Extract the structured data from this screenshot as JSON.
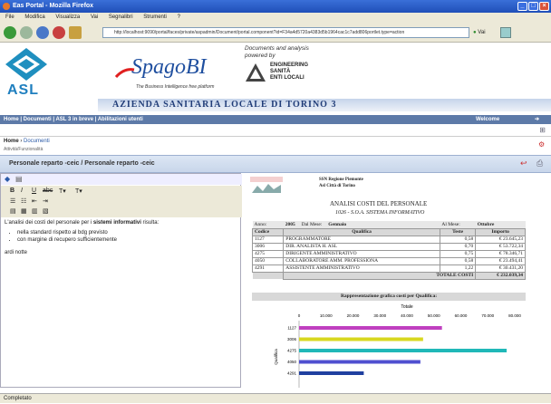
{
  "window": {
    "title": "Eas Portal - Mozilla Firefox"
  },
  "menu": [
    "File",
    "Modifica",
    "Visualizza",
    "Vai",
    "Segnalibri",
    "Strumenti",
    "?"
  ],
  "nav": {
    "url": "http://localhost:9090/portal/faces/private/aspadmin/Document/portal.component?id=F34a4d5720a4383d5b1964cac1c7add806portlet.type=action",
    "go_label": "Vai"
  },
  "banner": {
    "asl": "ASL",
    "spago": "SpagoBI",
    "spago_sub": "The Business Intelligence free platform",
    "docs_line1": "Documents and analysis",
    "docs_line2": "powered by",
    "eng1": "ENGINEERING",
    "eng2": "SANITÀ",
    "eng3": "ENTI LOCALI",
    "azienda": "AZIENDA SANITARIA LOCALE DI TORINO 3"
  },
  "topnav": "Home | Documenti | ASL 3 in breve | Abilitazioni utenti",
  "topnav_right": "Welcome",
  "breadcrumb": {
    "home": "Home",
    "sep": " › ",
    "current": "Documenti",
    "sub": "Attività/Funzionalità"
  },
  "panel": {
    "title": "Personale reparto -ceic / Personale reparto -ceic"
  },
  "editor": {
    "intro_plain": "L'analisi dei costi del personale per i ",
    "intro_bold": "sistemi informativi",
    "intro_end": " risulta:",
    "bullets": [
      "nella standard rispetto al bdg previsto",
      "con margine di recupero sufficientemente"
    ],
    "footer": "ardi notte"
  },
  "report": {
    "org1": "SSN Regione Piemonte",
    "org2": "Asl Città di Torino",
    "title": "ANALISI COSTI DEL PERSONALE",
    "subtitle": "1026 - S.O.A. SISTEMA INFORMATIVO",
    "filter": {
      "anno_label": "Anno:",
      "anno": "2005",
      "dal_label": "Dal Mese:",
      "dal": "Gennaio",
      "al_label": "Al Mese:",
      "al": "Ottobre"
    },
    "headers": [
      "Codice",
      "Qualifica",
      "Teste",
      "Importo"
    ],
    "rows": [
      [
        "1127",
        "PROGRAMMATORE",
        "0,58",
        "€ 23.645,23"
      ],
      [
        "3006",
        "DIR. ANALISTA H. ASL",
        "0,70",
        "€ 53.722,34"
      ],
      [
        "4275",
        "DIRIGENTE AMMINISTRATIVO",
        "0,75",
        "€ 78.346,71"
      ],
      [
        "4050",
        "COLLABORATORE AMM. PROFESSIONA",
        "0,58",
        "€ 23.494,41"
      ],
      [
        "4291",
        "ASSISTENTE AMMINISTRATIVO",
        "1,22",
        "€ 30.431,20"
      ]
    ],
    "total_label": "TOTALE COSTI",
    "total": "€ 232.039,34",
    "chart_title": "Rappresentazione grafica costi per Qualifica:"
  },
  "chart_data": {
    "type": "bar",
    "orientation": "horizontal",
    "title": "Totale",
    "ylabel": "Qualifica",
    "categories": [
      "1127",
      "3006",
      "4275",
      "4050",
      "4291"
    ],
    "values": [
      53000,
      46000,
      77000,
      45000,
      24000
    ],
    "xlim": [
      0,
      80000
    ],
    "ticks": [
      "0",
      "10.000",
      "20.000",
      "30.000",
      "40.000",
      "50.000",
      "60.000",
      "70.000",
      "80.000"
    ],
    "colors": [
      "#c040c0",
      "#d8d820",
      "#20b8b8",
      "#5050d0",
      "#2040a0"
    ]
  },
  "status": "Completato"
}
